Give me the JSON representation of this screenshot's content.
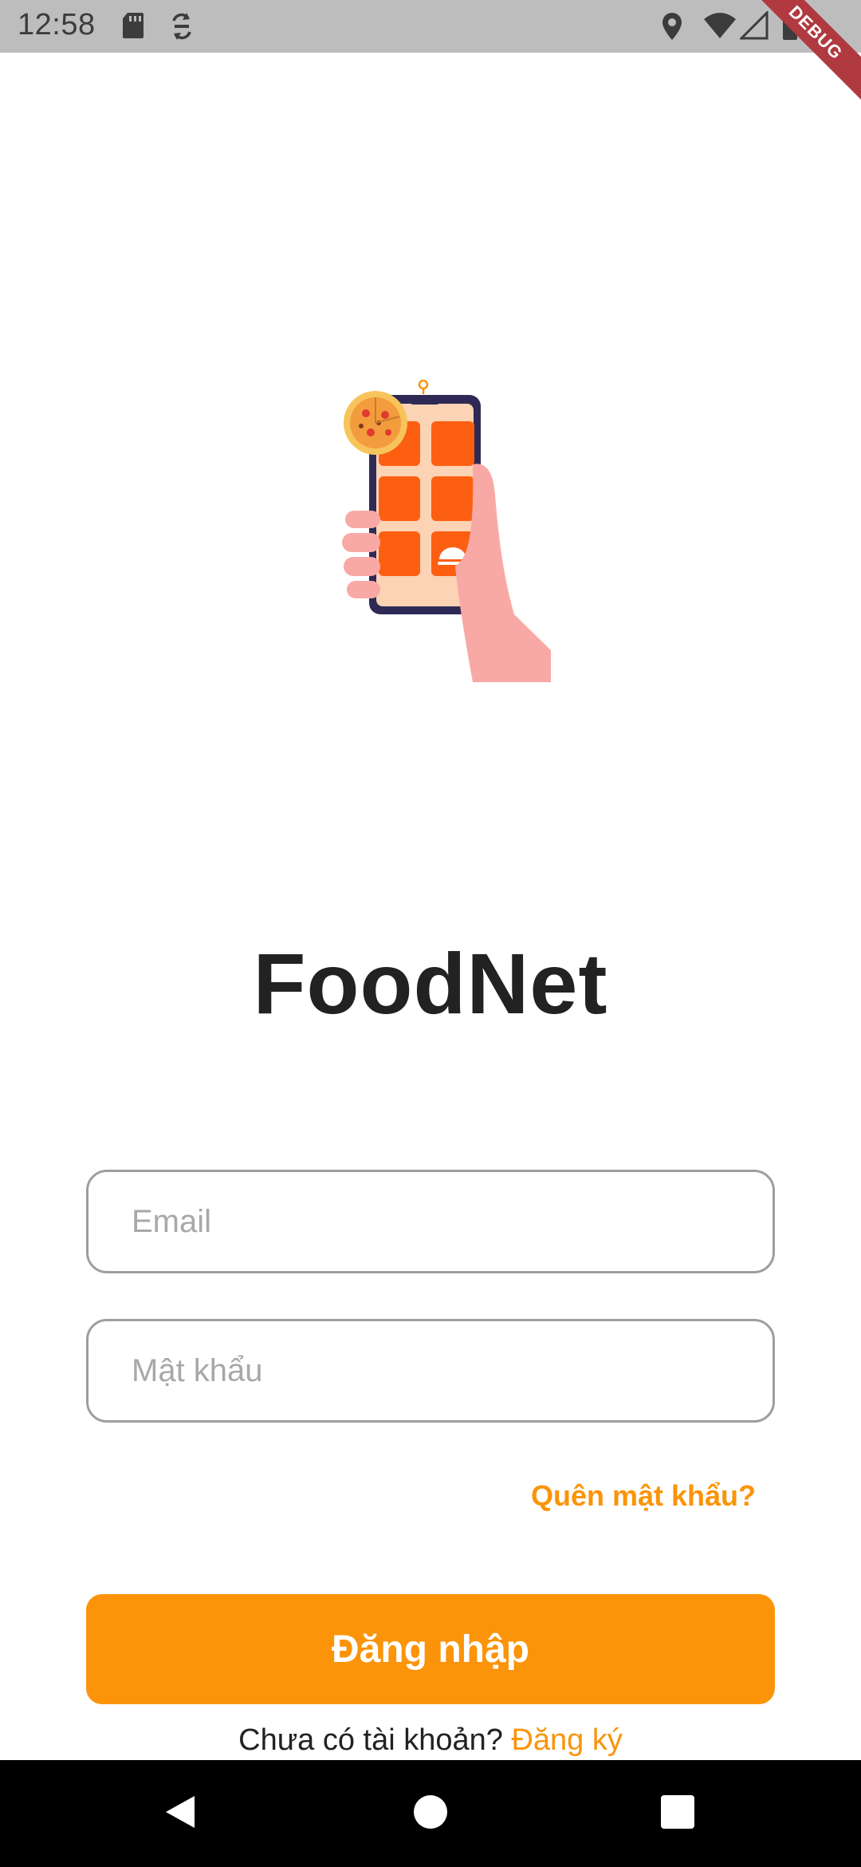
{
  "status_bar": {
    "time": "12:58",
    "left_icons": [
      "sd-card-icon",
      "sync-icon"
    ],
    "right_icons": [
      "location-icon",
      "wifi-icon",
      "signal-icon",
      "battery-icon"
    ],
    "debug_label": "DEBUG"
  },
  "illustration": {
    "icon": "phone-food-app-illustration",
    "colors": {
      "accent": "#fd5f12",
      "screen": "#fcd3b4",
      "hand": "#f9a9a5",
      "frame": "#2f2a55"
    }
  },
  "app": {
    "title": "FoodNet"
  },
  "form": {
    "email_placeholder": "Email",
    "password_placeholder": "Mật khẩu",
    "forgot_password": "Quên mật khẩu?",
    "login_button": "Đăng nhập",
    "no_account_text": "Chưa có tài khoản?",
    "signup_link": "Đăng ký"
  },
  "nav_bar": {
    "buttons": [
      "back-icon",
      "home-icon",
      "recents-icon"
    ]
  },
  "colors": {
    "brand": "#fb9409",
    "title": "#222222",
    "border": "#9e9e9e",
    "placeholder": "#a8a8a8"
  }
}
